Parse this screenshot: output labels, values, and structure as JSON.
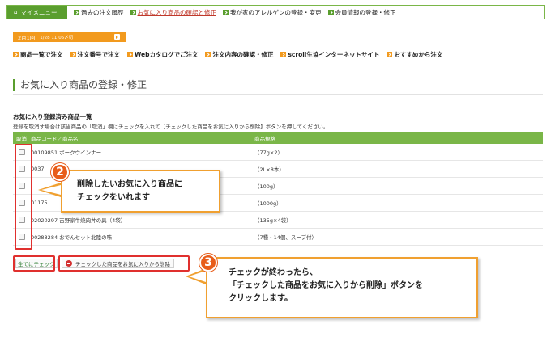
{
  "topnav": {
    "mymenu_label": "マイメニュー",
    "links": [
      {
        "label": "過去の注文履歴"
      },
      {
        "label": "お気に入り商品の確認と修正"
      },
      {
        "label": "我が家のアレルゲンの登録・変更"
      },
      {
        "label": "会員情報の登録・修正"
      }
    ]
  },
  "datebar": {
    "main": "2月1回",
    "sub": "1/28 11:05〆切"
  },
  "subnav": [
    {
      "label": "商品一覧で注文"
    },
    {
      "label": "注文番号で注文"
    },
    {
      "label": "Webカタログでご注文"
    },
    {
      "label": "注文内容の確認・修正"
    },
    {
      "label": "scroll生協インターネットサイト"
    },
    {
      "label": "おすすめから注文"
    }
  ],
  "page_title": "お気に入り商品の登録・修正",
  "section": {
    "title": "お気に入り登録済み商品一覧",
    "description": "登録を取消す場合は該当商品の「取消」欄にチェックを入れて【チェックした商品をお気に入りから削除】ボタンを押してください。"
  },
  "table": {
    "headers": {
      "cancel": "取消",
      "code_name": "商品コード／商品名",
      "spec": "商品規格"
    },
    "rows": [
      {
        "code_name": "00109851 ポークウインナー",
        "spec": "（77g×2）"
      },
      {
        "code_name": "0037",
        "spec": "（2L×8本）"
      },
      {
        "code_name": "",
        "spec": "（100g）"
      },
      {
        "code_name": "01175",
        "spec": "（1000g）"
      },
      {
        "code_name": "02020297 吉野家牛焼肉丼の具（4袋）",
        "spec": "（135g×4袋）"
      },
      {
        "code_name": "00288284 おでんセット北陸の味",
        "spec": "（7種・14個、スープ付）"
      }
    ]
  },
  "buttons": {
    "check_all": "全てにチェック",
    "delete": "チェックした商品をお気に入りから削除"
  },
  "callouts": {
    "step2": {
      "number": "2",
      "line1": "削除したいお気に入り商品に",
      "line2": "チェックをいれます"
    },
    "step3": {
      "number": "3",
      "line1": "チェックが終わったら、",
      "line2": "「チェックした商品をお気に入りから削除」ボタンを",
      "line3": "クリックします。"
    }
  }
}
